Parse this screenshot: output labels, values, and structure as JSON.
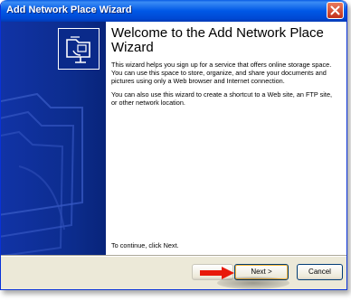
{
  "window": {
    "title": "Add Network Place Wizard"
  },
  "content": {
    "heading": "Welcome to the Add Network Place Wizard",
    "paragraph1": "This wizard helps you sign up for a service that offers online storage space. You can use this space to store, organize, and share your documents and pictures using only a Web browser and Internet connection.",
    "paragraph2": "You can also use this wizard to create a shortcut to a Web site, an FTP site, or other network location.",
    "continue_text": "To continue, click Next."
  },
  "buttons": {
    "back_label": "",
    "next_label": "Next >",
    "cancel_label": "Cancel"
  },
  "icons": {
    "close": "close-icon",
    "wizard": "network-folder-icon",
    "arrow": "red-arrow-icon"
  },
  "colors": {
    "titlebar": "#0058e6",
    "side_panel": "#0c2c8c",
    "dialog_bg": "#ece9d8",
    "arrow": "#e8190a"
  }
}
